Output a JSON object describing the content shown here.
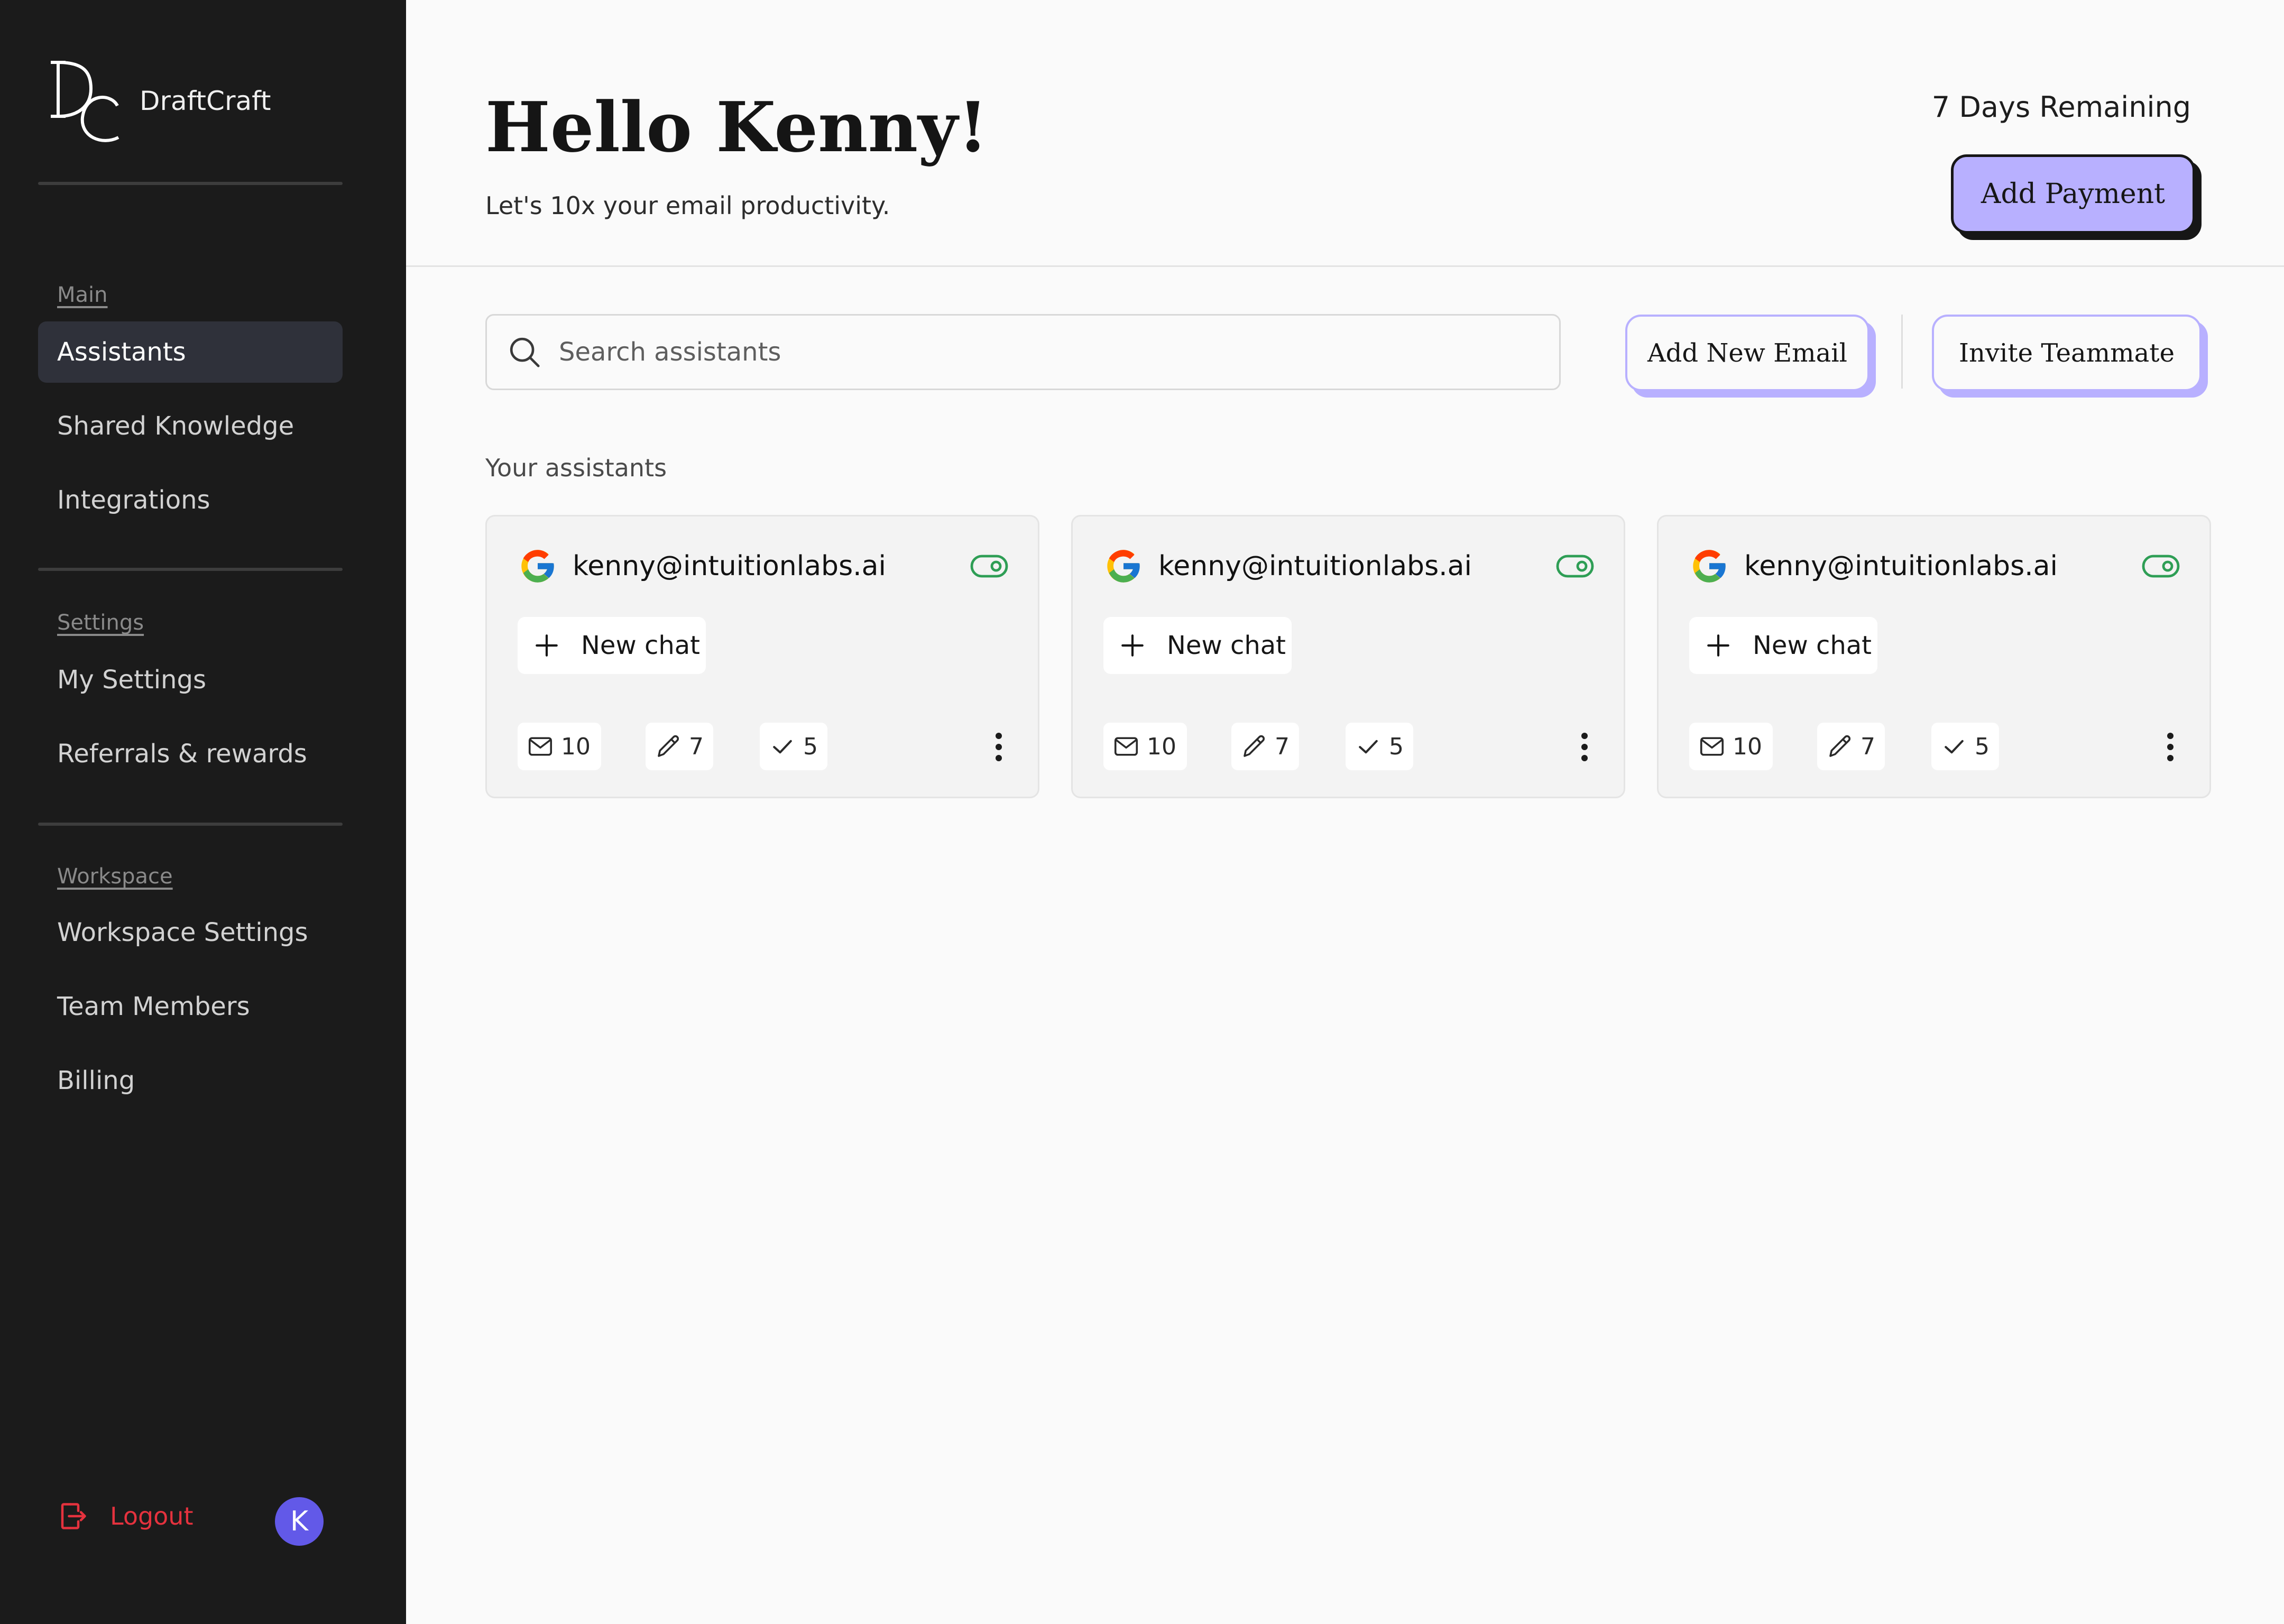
{
  "sidebar": {
    "brand": "DraftCraft",
    "sections": [
      {
        "label": "Main",
        "items": [
          {
            "label": "Assistants",
            "active": true
          },
          {
            "label": "Shared Knowledge"
          },
          {
            "label": "Integrations"
          }
        ]
      },
      {
        "label": "Settings",
        "items": [
          {
            "label": "My Settings"
          },
          {
            "label": "Referrals & rewards"
          }
        ]
      },
      {
        "label": "Workspace",
        "items": [
          {
            "label": "Workspace Settings"
          },
          {
            "label": "Team Members"
          },
          {
            "label": "Billing"
          }
        ]
      }
    ],
    "logout_label": "Logout",
    "avatar_initial": "K"
  },
  "header": {
    "greeting": "Hello Kenny!",
    "subtitle": "Let's 10x your email productivity.",
    "trial": "7 Days Remaining",
    "add_payment_label": "Add Payment"
  },
  "toolbar": {
    "search_placeholder": "Search assistants",
    "add_email_label": "Add New Email",
    "invite_label": "Invite Teammate"
  },
  "assistants_heading": "Your assistants",
  "assistants": [
    {
      "email": "kenny@intuitionlabs.ai",
      "new_chat_label": "New chat",
      "emails": "10",
      "drafts": "7",
      "sent": "5",
      "enabled": true
    },
    {
      "email": "kenny@intuitionlabs.ai",
      "new_chat_label": "New chat",
      "emails": "10",
      "drafts": "7",
      "sent": "5",
      "enabled": true
    },
    {
      "email": "kenny@intuitionlabs.ai",
      "new_chat_label": "New chat",
      "emails": "10",
      "drafts": "7",
      "sent": "5",
      "enabled": true
    }
  ],
  "colors": {
    "sidebar_bg": "#1b1b1b",
    "accent": "#b8b0ff",
    "logout": "#e5323e",
    "avatar": "#6259e8",
    "toggle_on": "#2e9e55"
  }
}
